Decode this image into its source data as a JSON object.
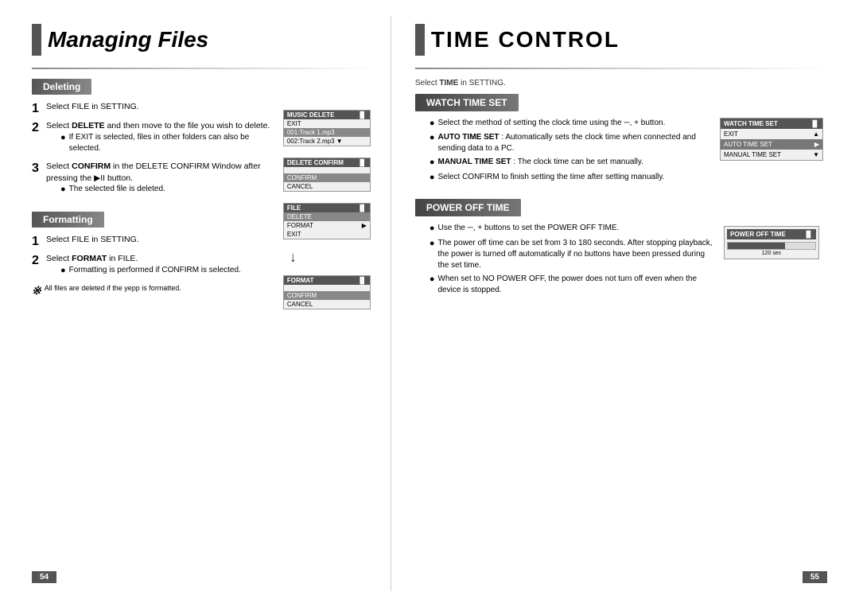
{
  "leftPage": {
    "title": "Managing Files",
    "titleBlock": true,
    "sections": {
      "deleting": {
        "header": "Deleting",
        "steps": [
          {
            "number": "1",
            "text": "Select FILE in SETTING."
          },
          {
            "number": "2",
            "text": "Select DELETE and then move to the file you wish to delete.",
            "bullets": [
              "If EXIT is selected, files in other folders can also be selected."
            ]
          },
          {
            "number": "3",
            "text": "Select CONFIRM in the DELETE CONFIRM Window after pressing the ▶II button.",
            "bullets": [
              "The selected file is deleted."
            ]
          }
        ]
      },
      "formatting": {
        "header": "Formatting",
        "steps": [
          {
            "number": "1",
            "text": "Select FILE in SETTING."
          },
          {
            "number": "2",
            "text": "Select FORMAT in FILE.",
            "bullets": [
              "Formatting is performed if CONFIRM is selected."
            ]
          }
        ],
        "note": {
          "symbol": "※",
          "text": "All files are deleted if the yepp is formatted."
        }
      }
    },
    "pageNumber": "54",
    "screens": {
      "musicDelete": {
        "title": "MUSIC DELETE",
        "items": [
          "EXIT",
          "001:Track 1.mp3",
          "002:Track 2.mp3"
        ]
      },
      "deleteConfirm": {
        "title": "DELETE CONFIRM",
        "items": [
          "CONFIRM",
          "CANCEL"
        ]
      },
      "file": {
        "title": "FILE",
        "items": [
          "DELETE",
          "FORMAT",
          "EXIT"
        ]
      },
      "format": {
        "title": "FORMAT",
        "items": [
          "CONFIRM",
          "CANCEL"
        ]
      }
    }
  },
  "rightPage": {
    "title": "TIME CONTROL",
    "selectTimeText": "Select TIME in SETTING.",
    "sections": {
      "watchTimeSet": {
        "header": "WATCH TIME SET",
        "description": "Select the method of setting the clock time using the ─, + button.",
        "items": [
          {
            "label": "AUTO TIME SET",
            "bold": true,
            "text": ": Automatically sets the clock time when connected and sending data to a PC."
          },
          {
            "label": "MANUAL TIME SET",
            "bold": true,
            "text": ": The clock time can be set manually."
          }
        ],
        "confirm": "Select CONFIRM to finish setting the time after setting manually.",
        "screen": {
          "title": "WATCH TIME SET",
          "items": [
            {
              "text": "EXIT",
              "arrow": "▲"
            },
            {
              "text": "AUTO TIME SET",
              "arrow": "▶",
              "selected": true
            },
            {
              "text": "MANUAL TIME SET",
              "arrow": "▼"
            }
          ]
        }
      },
      "powerOffTime": {
        "header": "POWER OFF TIME",
        "bullets": [
          "Use the ─, + buttons to set the POWER OFF TIME.",
          "The power off time can be set from 3 to 180 seconds. After stopping playback, the power is turned off automatically if no buttons have been pressed during the set time.",
          "When set to NO POWER OFF, the power does not turn off even when the device is stopped."
        ],
        "screen": {
          "title": "POWER OFF TIME",
          "value": "120 sec"
        }
      }
    },
    "pageNumber": "55"
  }
}
